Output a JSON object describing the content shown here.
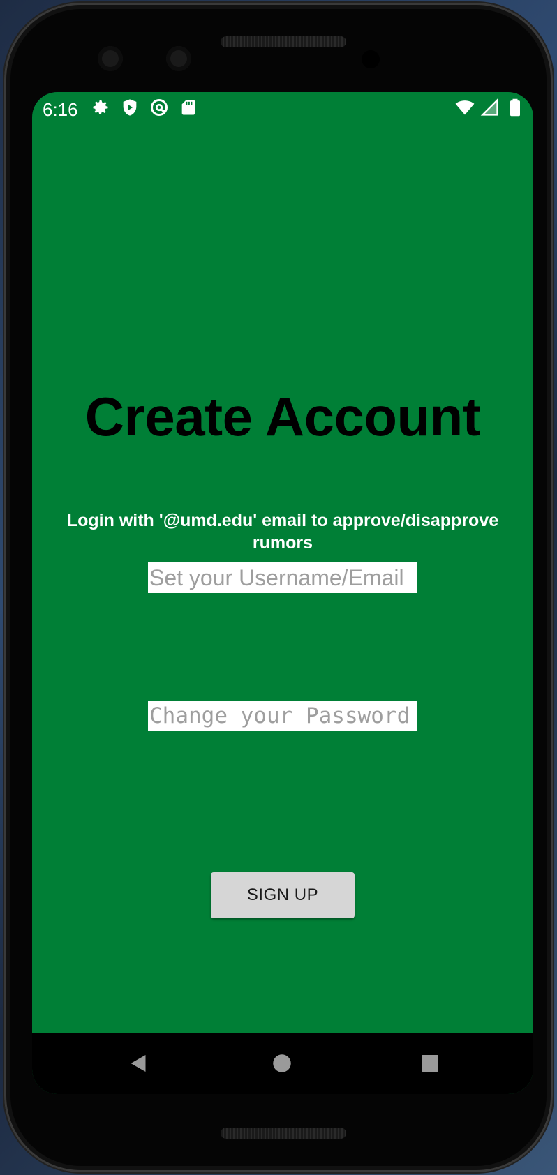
{
  "status_bar": {
    "time": "6:16",
    "left_icons": [
      "settings-icon",
      "shield-play-icon",
      "at-sign-icon",
      "sd-card-icon"
    ],
    "right_icons": [
      "wifi-icon",
      "cell-signal-icon",
      "battery-icon"
    ]
  },
  "screen": {
    "title": "Create Account",
    "subtitle": "Login with '@umd.edu' email to approve/disapprove rumors",
    "username_placeholder": "Set your Username/Email",
    "password_placeholder": "Change your Password",
    "signup_label": "SIGN UP"
  },
  "nav": {
    "icons": [
      "back-icon",
      "home-icon",
      "recents-icon"
    ]
  },
  "colors": {
    "background": "#007f36",
    "title": "#000000",
    "button": "#d6d6d6"
  }
}
